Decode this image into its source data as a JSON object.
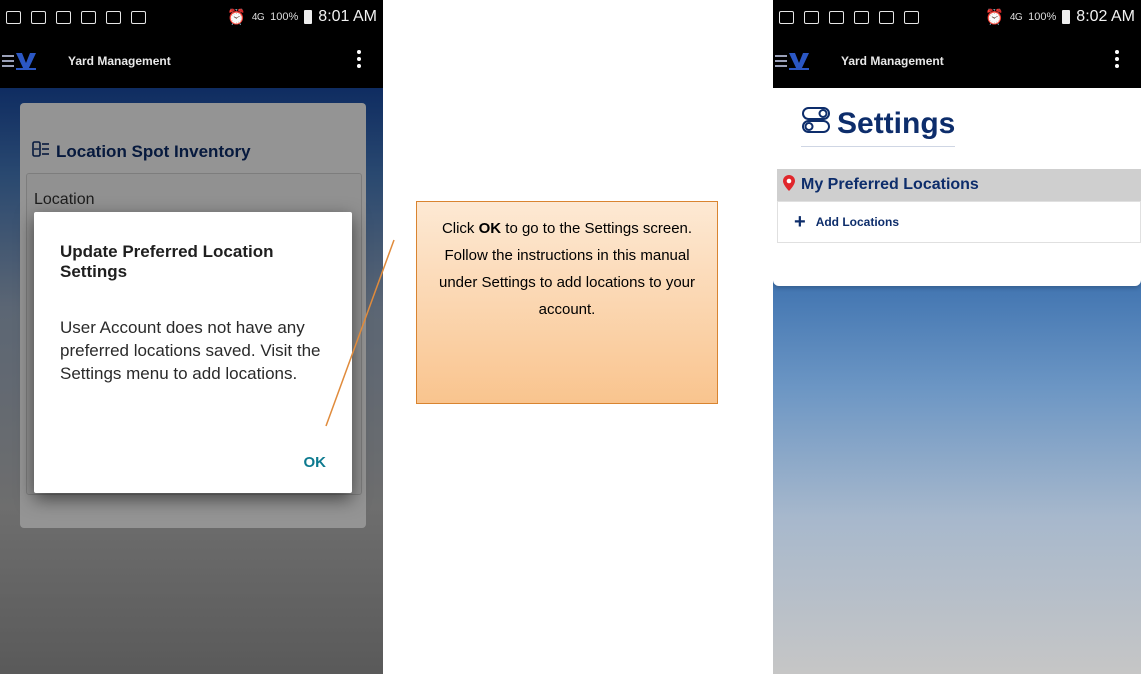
{
  "left_phone": {
    "status": {
      "battery": "100%",
      "time": "8:01 AM",
      "network": "4G"
    },
    "app_title": "Yard Management",
    "card": {
      "title": "Location Spot Inventory",
      "location_label": "Location"
    },
    "dialog": {
      "title": "Update Preferred Location Settings",
      "body": "User Account does not have any preferred locations saved. Visit the Settings menu to add locations.",
      "ok_label": "OK"
    }
  },
  "callout": {
    "pre": "Click ",
    "bold": "OK",
    "post": " to go to the Settings screen.",
    "line2": "Follow the instructions in this manual under Settings to add locations to your account."
  },
  "right_phone": {
    "status": {
      "battery": "100%",
      "time": "8:02 AM",
      "network": "4G"
    },
    "app_title": "Yard Management",
    "settings_title": "Settings",
    "preferred_locations_header": "My Preferred Locations",
    "add_locations_label": "Add Locations"
  },
  "colors": {
    "navy": "#0d2d6b",
    "ok_teal": "#0d7a8f",
    "pin_red": "#e0262b",
    "callout_border": "#d98430"
  },
  "icons": [
    "menu-icon",
    "logo-icon",
    "overflow-menu-icon",
    "inventory-icon",
    "settings-toggle-icon",
    "map-pin-icon",
    "plus-icon",
    "alarm-icon",
    "battery-icon",
    "signal-icon"
  ]
}
